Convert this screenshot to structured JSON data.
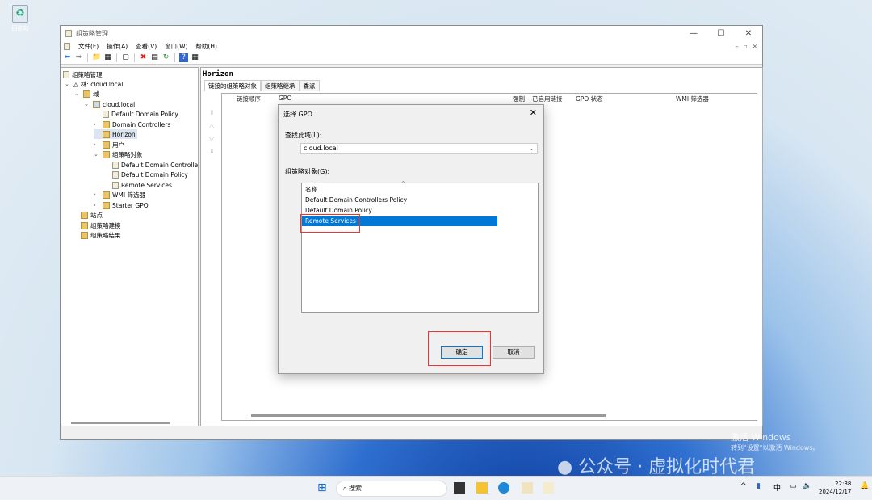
{
  "desktop": {
    "recycle_bin": "回收站"
  },
  "window": {
    "title": "组策略管理",
    "menu": [
      "文件(F)",
      "操作(A)",
      "查看(V)",
      "窗口(W)",
      "帮助(H)"
    ]
  },
  "tree": {
    "root": "组策略管理",
    "forest": "林: cloud.local",
    "domains": "域",
    "domain": "cloud.local",
    "items": [
      "Default Domain Policy",
      "Domain Controllers",
      "Horizon",
      "用户",
      "组策略对象",
      "Default Domain Controlle",
      "Default Domain Policy",
      "Remote Services",
      "WMI 筛选器",
      "Starter GPO",
      "站点",
      "组策略建模",
      "组策略结果"
    ]
  },
  "right": {
    "title": "Horizon",
    "tabs": [
      "链接的组策略对象",
      "组策略继承",
      "委派"
    ],
    "columns": [
      "链接顺序",
      "GPO",
      "强制",
      "已启用链接",
      "GPO 状态",
      "WMI 筛选器"
    ]
  },
  "dialog": {
    "title": "选择 GPO",
    "domain_label": "查找此域(L):",
    "domain_value": "cloud.local",
    "gpo_label": "组策略对象(G):",
    "list_header": "名称",
    "items": [
      "Default Domain Controllers Policy",
      "Default Domain Policy",
      "Remote Services"
    ],
    "selected": "Remote Services",
    "ok": "确定",
    "cancel": "取消"
  },
  "watermark": {
    "activate": "激活 Windows",
    "activate_hint": "转到\"设置\"以激活 Windows。",
    "account": "公众号 · 虚拟化时代君"
  },
  "taskbar": {
    "search": "搜索",
    "ime": "中",
    "time": "22:38",
    "date": "2024/12/17"
  }
}
